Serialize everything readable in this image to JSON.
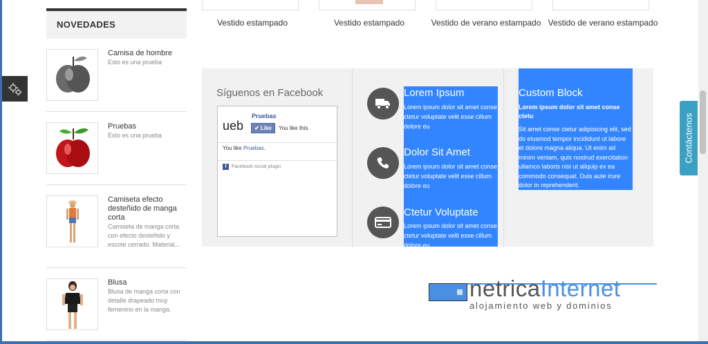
{
  "sidebar": {
    "title": "NOVEDADES",
    "products": [
      {
        "name": "Camisa de hombre",
        "desc": "Esto es una prueba"
      },
      {
        "name": "Pruebas",
        "desc": "Esto es una prueba"
      },
      {
        "name": "Camiseta efecto desteñido de manga corta",
        "desc": "Camiseta de manga corta con efecto desteñido y escote cerrado. Material..."
      },
      {
        "name": "Blusa",
        "desc": "Blusa de manga corta con detalle drapeado muy femenino en la manga."
      }
    ]
  },
  "products_row": [
    {
      "caption": "Vestido estampado"
    },
    {
      "caption": "Vestido estampado"
    },
    {
      "caption": "Vestido de verano estampado"
    },
    {
      "caption": "Vestido de verano estampado"
    }
  ],
  "facebook": {
    "title": "Síguenos en Facebook",
    "page_logo": "ueb",
    "page_name": "Pruebas",
    "like_label": "Like",
    "you_like_short": "You like this.",
    "you_like_prefix": "You like ",
    "you_like_page": "Pruebas",
    "you_like_suffix": ".",
    "plugin_label": "Facebook social plugin"
  },
  "features": [
    {
      "icon": "truck-icon",
      "title": "Lorem Ipsum",
      "text": "Lorem ipsum dolor sit amet conse ctetur voluptate velit esse cillum dolore eu"
    },
    {
      "icon": "phone-icon",
      "title": "Dolor Sit Amet",
      "text": "Lorem ipsum dolor sit amet conse ctetur voluptate velit esse cillum dolore eu"
    },
    {
      "icon": "credit-card-icon",
      "title": "Ctetur Voluptate",
      "text": "Lorem ipsum dolor sit amet conse ctetur voluptate velit esse cillum dolore eu"
    }
  ],
  "custom_block": {
    "title": "Custom Block",
    "subtitle": "Lorem ipsum dolor sit amet conse ctetu",
    "text": "Sit amet conse ctetur adipisicing elit, sed do eiusmod tempor incididunt ut labore et dolore magna aliqua. Ut enim ad minim veniam, quis nostrud exercitation ullamco laboris nisi ut aliquip ex ea commodo consequat. Duis aute irure dolor in reprehenderit."
  },
  "logo": {
    "part1": "netrica",
    "part2": "Internet",
    "tagline": "alojamiento web y dominios"
  },
  "contact_tab": "Contáctenos",
  "colors": {
    "highlight": "#3385ff",
    "contact_tab": "#3ba1c4",
    "logo_blue": "#4a90e2"
  }
}
